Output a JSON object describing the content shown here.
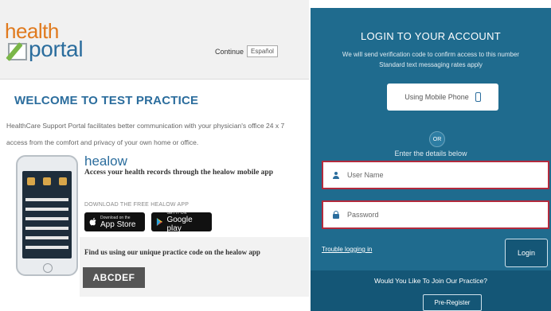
{
  "logo": {
    "line1": "health",
    "line2": "portal"
  },
  "language": {
    "label": "Continue",
    "selected": "Español"
  },
  "welcome": {
    "title": "WELCOME TO TEST PRACTICE"
  },
  "description": "HealthCare Support Portal facilitates better communication with your physician's office 24 x 7 access from the comfort and privacy of your own home or office.",
  "healow": {
    "brand": "healow",
    "tagline": "Access your health records through the healow mobile app",
    "download_text": "DOWNLOAD THE FREE HEALOW APP",
    "appstore": {
      "small": "Download on the",
      "big": "App Store"
    },
    "googleplay": {
      "small": "GET IT ON",
      "big": "Google play"
    },
    "find_text": "Find us using our unique practice code on the healow app",
    "practice_code": "ABCDEF"
  },
  "login": {
    "title": "LOGIN TO YOUR ACCOUNT",
    "info_line1": "We will send verification code to confirm access to this number",
    "info_line2": "Standard text messaging rates apply",
    "mobile_button": "Using Mobile Phone",
    "or": "OR",
    "enter_details": "Enter the details below",
    "username_placeholder": "User Name",
    "password_placeholder": "Password",
    "trouble_link": "Trouble logging in",
    "login_button": "Login",
    "join_text": "Would You Like To Join Our Practice?",
    "preregister_button": "Pre-Register"
  },
  "colors": {
    "panel": "#1f6b8e",
    "panel_dark": "#145676",
    "field_border": "#b22a3d",
    "brand_blue": "#2b6d9d",
    "brand_orange": "#e07a1e"
  },
  "icons": {
    "mobile": "mobile-phone-icon",
    "user": "user-icon",
    "password": "lock-icon",
    "apple": "apple-icon",
    "google_play": "google-play-icon"
  }
}
